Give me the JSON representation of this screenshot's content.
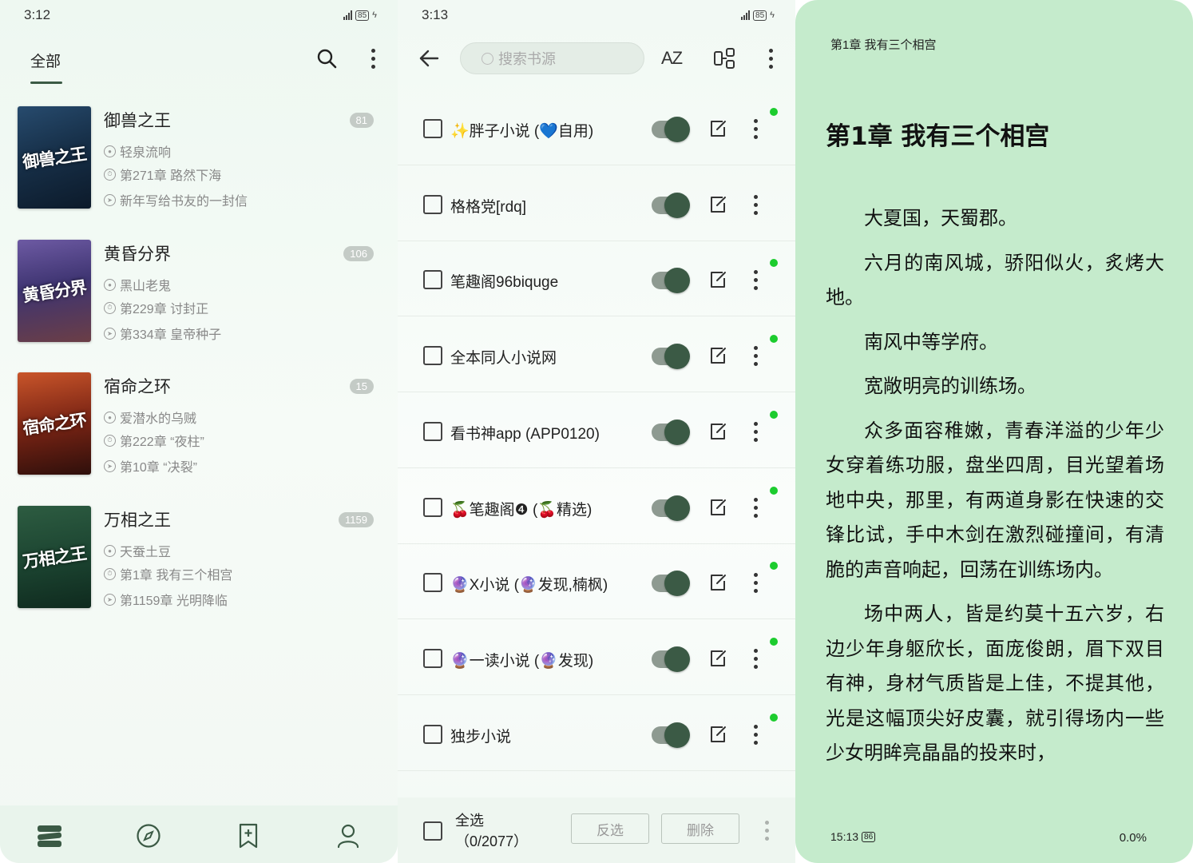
{
  "panel1": {
    "status": {
      "time": "3:12",
      "battery": "85"
    },
    "tab_all": "全部",
    "books": [
      {
        "title": "御兽之王",
        "badge": "81",
        "author": "轻泉流响",
        "current": "第271章 路然下海",
        "latest": "新年写给书友的一封信",
        "cover_text": "御兽之王",
        "cover_bg": "linear-gradient(160deg,#274b6e 0%,#173049 45%,#0c1a2a 100%)"
      },
      {
        "title": "黄昏分界",
        "badge": "106",
        "author": "黑山老鬼",
        "current": "第229章 讨封正",
        "latest": "第334章 皇帝种子",
        "cover_text": "黄昏分界",
        "cover_bg": "linear-gradient(170deg,#6d5aa3 0%,#3e3471 45%,#6b3e46 100%)"
      },
      {
        "title": "宿命之环",
        "badge": "15",
        "author": "爱潜水的乌贼",
        "current": "第222章 “夜柱”",
        "latest": "第10章 “决裂”",
        "cover_text": "宿命之环",
        "cover_bg": "linear-gradient(170deg,#c9552a 0%,#7a2414 50%,#2e0f0b 100%)"
      },
      {
        "title": "万相之王",
        "badge": "1159",
        "author": "天蚕土豆",
        "current": "第1章 我有三个相宫",
        "latest": "第1159章 光明降临",
        "cover_text": "万相之王",
        "cover_bg": "linear-gradient(170deg,#2d5c41 0%,#1b4330 55%,#0f2a1e 100%)"
      }
    ]
  },
  "panel2": {
    "status": {
      "time": "3:13",
      "battery": "85"
    },
    "search_placeholder": "搜索书源",
    "sort_label": "AZ",
    "sources": [
      {
        "name": "✨胖子小说 (💙自用)",
        "dot": true
      },
      {
        "name": "格格党[rdq]",
        "dot": false
      },
      {
        "name": "笔趣阁96biquge",
        "dot": true
      },
      {
        "name": "全本同人小说网",
        "dot": true
      },
      {
        "name": "看书神app (APP0120)",
        "dot": true
      },
      {
        "name": "🍒笔趣阁❹ (🍒精选)",
        "dot": true
      },
      {
        "name": "🔮X小说 (🔮发现,楠枫)",
        "dot": true
      },
      {
        "name": "🔮一读小说 (🔮发现)",
        "dot": true
      },
      {
        "name": "独步小说",
        "dot": true
      }
    ],
    "select_all": "全选",
    "count": "（0/2077）",
    "invert_btn": "反选",
    "delete_btn": "删除"
  },
  "panel3": {
    "header": "第1章 我有三个相宫",
    "title": "第1章 我有三个相宫",
    "paragraphs": [
      "大夏国，天蜀郡。",
      "六月的南风城，骄阳似火，炙烤大地。",
      "南风中等学府。",
      "宽敞明亮的训练场。",
      "众多面容稚嫩，青春洋溢的少年少女穿着练功服，盘坐四周，目光望着场地中央，那里，有两道身影在快速的交锋比试，手中木剑在激烈碰撞间，有清脆的声音响起，回荡在训练场内。",
      "场中两人，皆是约莫十五六岁，右边少年身躯欣长，面庞俊朗，眉下双目有神，身材气质皆是上佳，不提其他，光是这幅顶尖好皮囊，就引得场内一些少女明眸亮晶晶的投来时，"
    ],
    "footer_time": "15:13",
    "footer_battery": "86",
    "progress": "0.0%"
  },
  "colors": {
    "accent": "#3b5a45",
    "reader_bg": "#c5ebcc",
    "online_dot": "#1ccc2e"
  }
}
